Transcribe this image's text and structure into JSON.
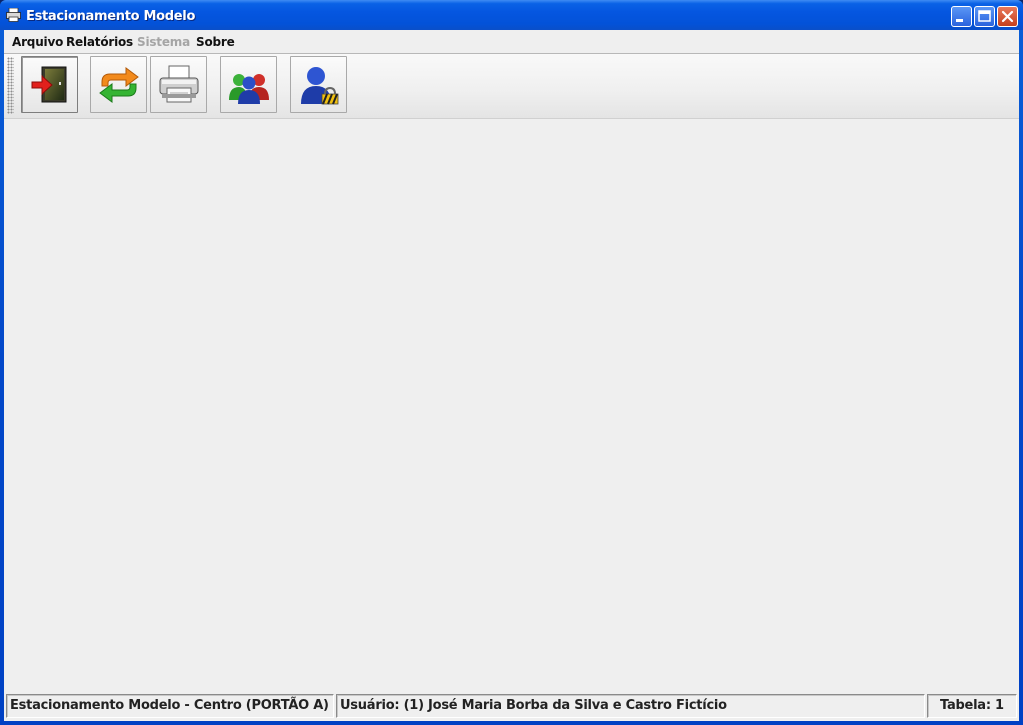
{
  "window": {
    "title": "Estacionamento Modelo",
    "controls": {
      "minimize": "minimize-icon",
      "maximize": "maximize-icon",
      "close": "close-icon"
    }
  },
  "menu": [
    {
      "label": "Arquivo",
      "enabled": true
    },
    {
      "label": "Relatórios",
      "enabled": true
    },
    {
      "label": "Sistema",
      "enabled": false
    },
    {
      "label": "Sobre",
      "enabled": true
    }
  ],
  "toolbar": {
    "buttons": [
      {
        "icon": "exit-door-icon",
        "pressed": true
      },
      {
        "icon": "swap-arrows-icon",
        "pressed": false
      },
      {
        "icon": "printer-icon",
        "pressed": false
      },
      {
        "icon": "users-group-icon",
        "pressed": false
      },
      {
        "icon": "user-lock-icon",
        "pressed": false
      }
    ]
  },
  "status": {
    "location": "Estacionamento Modelo - Centro (PORTÃO A)",
    "user": "Usuário: (1) José Maria Borba da Silva e Castro Fictício",
    "table": "Tabela: 1"
  },
  "colors": {
    "titlebar": "#0556e0",
    "client_background": "#efefef",
    "close_button": "#c5401d"
  }
}
